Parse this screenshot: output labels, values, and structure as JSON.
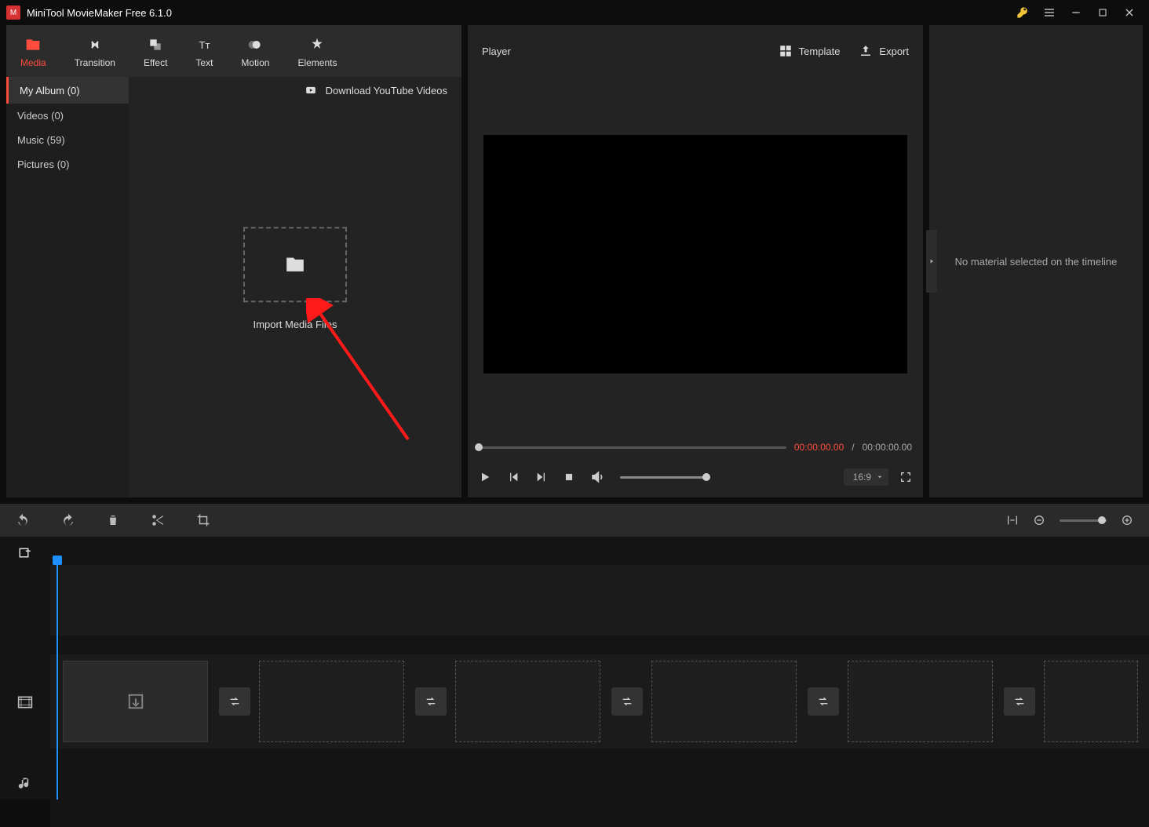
{
  "app": {
    "title": "MiniTool MovieMaker Free 6.1.0"
  },
  "tabs": {
    "media": "Media",
    "transition": "Transition",
    "effect": "Effect",
    "text": "Text",
    "motion": "Motion",
    "elements": "Elements"
  },
  "sidebar": {
    "album": "My Album (0)",
    "videos": "Videos (0)",
    "music": "Music (59)",
    "pictures": "Pictures (0)"
  },
  "media_area": {
    "youtube": "Download YouTube Videos",
    "import": "Import Media Files"
  },
  "player": {
    "title": "Player",
    "template": "Template",
    "export": "Export",
    "time_current": "00:00:00.00",
    "time_sep": "/",
    "time_total": "00:00:00.00",
    "aspect": "16:9"
  },
  "inspector": {
    "empty": "No material selected on the timeline"
  }
}
